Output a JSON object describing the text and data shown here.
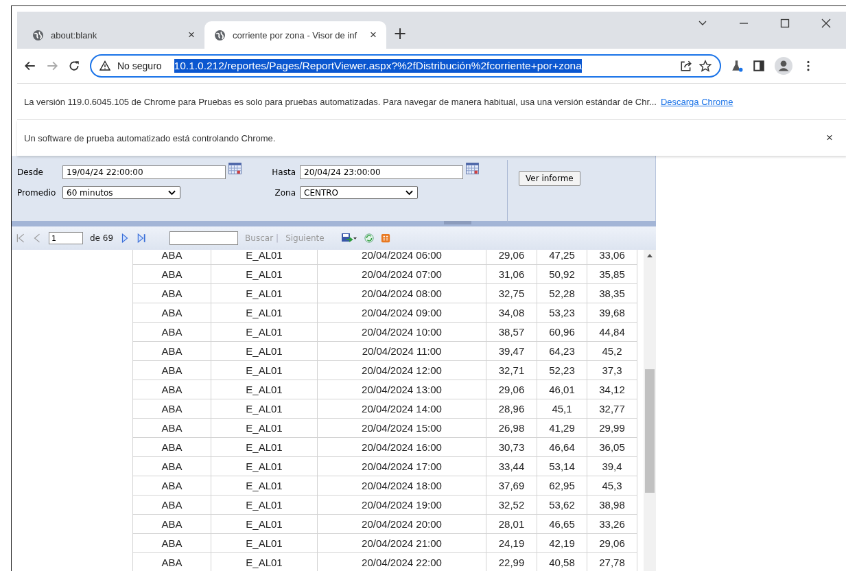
{
  "tabs": [
    {
      "title": "about:blank",
      "close": "×",
      "selected": false
    },
    {
      "title": "corriente por zona - Visor de inf",
      "close": "×",
      "selected": true
    }
  ],
  "new_tab": "+",
  "address_bar": {
    "security": "No seguro",
    "url": "10.1.0.212/reportes/Pages/ReportViewer.aspx?%2fDistribución%2fcorriente+por+zona"
  },
  "infobars": [
    {
      "text": "La versión 119.0.6045.105 de Chrome para Pruebas es solo para pruebas automatizadas. Para navegar de manera habitual, usa una versión estándar de Chr...",
      "link": "Descarga Chrome"
    },
    {
      "text": "Un software de prueba automatizado está controlando Chrome.",
      "close": "×"
    }
  ],
  "parameters": {
    "desde_label": "Desde",
    "desde": "19/04/24 22:00:00",
    "hasta_label": "Hasta",
    "hasta": "20/04/24 23:00:00",
    "promedio_label": "Promedio",
    "promedio": "60 minutos",
    "zona_label": "Zona",
    "zona": "CENTRO",
    "button": "Ver informe"
  },
  "toolbar": {
    "page": "1",
    "page_count": "de 69",
    "find": "Buscar",
    "separator": "|",
    "next": "Siguiente"
  },
  "table": {
    "rows": [
      [
        "ABA",
        "E_AL01",
        "20/04/2024 06:00",
        "29,06",
        "47,25",
        "33,06"
      ],
      [
        "ABA",
        "E_AL01",
        "20/04/2024 07:00",
        "31,06",
        "50,92",
        "35,85"
      ],
      [
        "ABA",
        "E_AL01",
        "20/04/2024 08:00",
        "32,75",
        "52,28",
        "38,35"
      ],
      [
        "ABA",
        "E_AL01",
        "20/04/2024 09:00",
        "34,08",
        "53,23",
        "39,68"
      ],
      [
        "ABA",
        "E_AL01",
        "20/04/2024 10:00",
        "38,57",
        "60,96",
        "44,84"
      ],
      [
        "ABA",
        "E_AL01",
        "20/04/2024 11:00",
        "39,47",
        "64,23",
        "45,2"
      ],
      [
        "ABA",
        "E_AL01",
        "20/04/2024 12:00",
        "32,71",
        "52,23",
        "37,3"
      ],
      [
        "ABA",
        "E_AL01",
        "20/04/2024 13:00",
        "29,06",
        "46,01",
        "34,12"
      ],
      [
        "ABA",
        "E_AL01",
        "20/04/2024 14:00",
        "28,96",
        "45,1",
        "32,77"
      ],
      [
        "ABA",
        "E_AL01",
        "20/04/2024 15:00",
        "26,98",
        "41,29",
        "29,99"
      ],
      [
        "ABA",
        "E_AL01",
        "20/04/2024 16:00",
        "30,73",
        "46,64",
        "36,05"
      ],
      [
        "ABA",
        "E_AL01",
        "20/04/2024 17:00",
        "33,44",
        "53,14",
        "39,4"
      ],
      [
        "ABA",
        "E_AL01",
        "20/04/2024 18:00",
        "37,69",
        "62,95",
        "45,3"
      ],
      [
        "ABA",
        "E_AL01",
        "20/04/2024 19:00",
        "32,52",
        "53,62",
        "38,98"
      ],
      [
        "ABA",
        "E_AL01",
        "20/04/2024 20:00",
        "28,01",
        "46,65",
        "33,26"
      ],
      [
        "ABA",
        "E_AL01",
        "20/04/2024 21:00",
        "24,19",
        "42,19",
        "29,06"
      ],
      [
        "ABA",
        "E_AL01",
        "20/04/2024 22:00",
        "22,99",
        "40,58",
        "27,78"
      ]
    ]
  }
}
